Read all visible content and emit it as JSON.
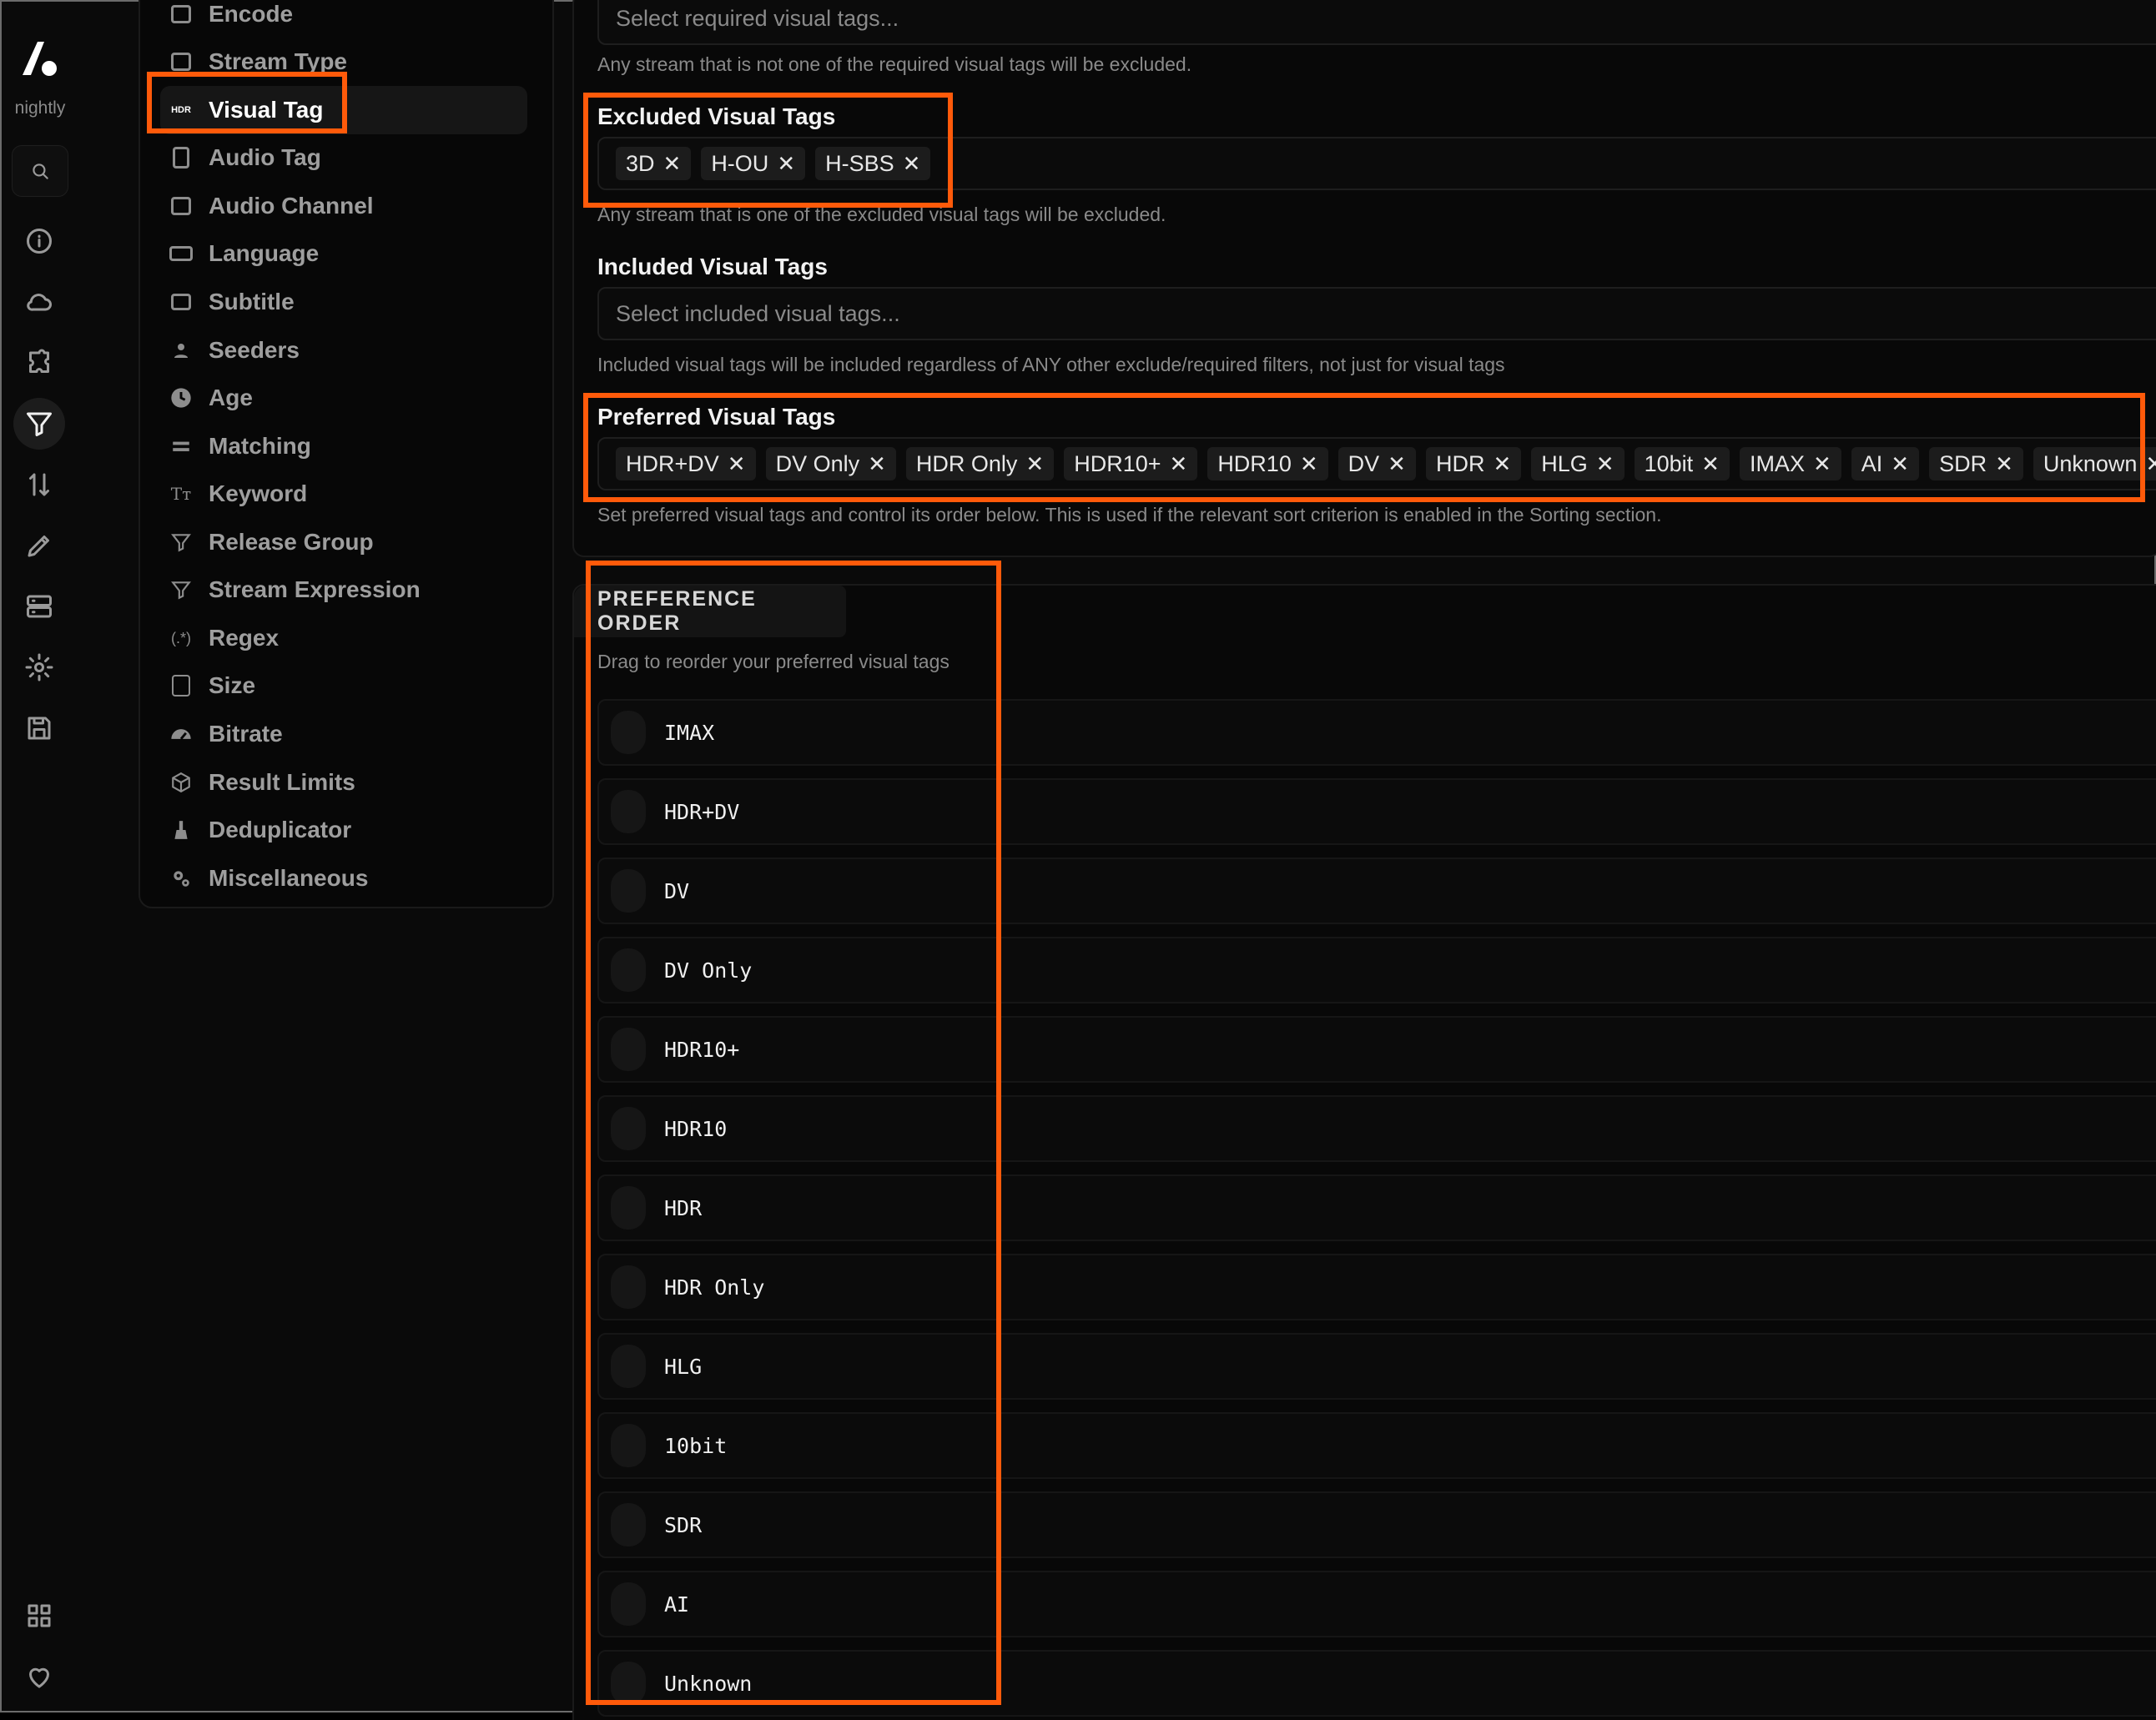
{
  "rail": {
    "brand_label": "nightly",
    "icons": [
      "search-icon",
      "info-icon",
      "cloud-icon",
      "puzzle-icon",
      "filter-icon",
      "sort-icon",
      "brush-icon",
      "server-icon",
      "gear-icon",
      "save-icon",
      "grid-icon",
      "heart-icon"
    ],
    "active": "filter-icon"
  },
  "nav": {
    "items": [
      {
        "label": "Encode",
        "icon": "film-icon"
      },
      {
        "label": "Stream Type",
        "icon": "play-box-icon"
      },
      {
        "label": "Visual Tag",
        "icon": "hdr-icon",
        "badge": "HDR"
      },
      {
        "label": "Audio Tag",
        "icon": "speaker-icon"
      },
      {
        "label": "Audio Channel",
        "icon": "channel-icon"
      },
      {
        "label": "Language",
        "icon": "translate-icon"
      },
      {
        "label": "Subtitle",
        "icon": "subtitle-icon"
      },
      {
        "label": "Seeders",
        "icon": "user-icon"
      },
      {
        "label": "Age",
        "icon": "clock-icon"
      },
      {
        "label": "Matching",
        "icon": "equals-icon"
      },
      {
        "label": "Keyword",
        "icon": "text-icon"
      },
      {
        "label": "Release Group",
        "icon": "group-filter-icon"
      },
      {
        "label": "Stream Expression",
        "icon": "expression-icon"
      },
      {
        "label": "Regex",
        "icon": "regex-icon",
        "glyph": "(.*)"
      },
      {
        "label": "Size",
        "icon": "size-icon"
      },
      {
        "label": "Bitrate",
        "icon": "gauge-icon"
      },
      {
        "label": "Result Limits",
        "icon": "box-icon"
      },
      {
        "label": "Deduplicator",
        "icon": "broom-icon"
      },
      {
        "label": "Miscellaneous",
        "icon": "cogs-icon"
      }
    ],
    "active": "Visual Tag"
  },
  "required": {
    "placeholder": "Select required visual tags...",
    "help": "Any stream that is not one of the required visual tags will be excluded."
  },
  "excluded": {
    "label": "Excluded Visual Tags",
    "chips": [
      "3D",
      "H-OU",
      "H-SBS"
    ],
    "help": "Any stream that is one of the excluded visual tags will be excluded."
  },
  "included": {
    "label": "Included Visual Tags",
    "placeholder": "Select included visual tags...",
    "help": "Included visual tags will be included regardless of ANY other exclude/required filters, not just for visual tags"
  },
  "preferred": {
    "label": "Preferred Visual Tags",
    "chips": [
      "HDR+DV",
      "DV Only",
      "HDR Only",
      "HDR10+",
      "HDR10",
      "DV",
      "HDR",
      "HLG",
      "10bit",
      "IMAX",
      "AI",
      "SDR",
      "Unknown"
    ],
    "help": "Set preferred visual tags and control its order below. This is used if the relevant sort criterion is enabled in the Sorting section."
  },
  "preference_order": {
    "title": "PREFERENCE ORDER",
    "subtitle": "Drag to reorder your preferred visual tags",
    "items": [
      "IMAX",
      "HDR+DV",
      "DV",
      "DV Only",
      "HDR10+",
      "HDR10",
      "HDR",
      "HDR Only",
      "HLG",
      "10bit",
      "SDR",
      "AI",
      "Unknown"
    ]
  },
  "colors": {
    "highlight": "#ff5a0a",
    "background": "#0a0a0a"
  }
}
